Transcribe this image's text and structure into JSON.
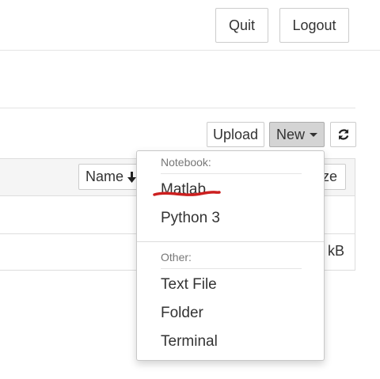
{
  "header": {
    "quit_label": "Quit",
    "logout_label": "Logout"
  },
  "toolbar": {
    "upload_label": "Upload",
    "new_label": "New",
    "refresh_icon": "refresh-icon"
  },
  "file_list": {
    "name_column": "Name",
    "sort_icon": "arrow-down-icon",
    "size_column_partial": "ze",
    "row_size_partial": "kB"
  },
  "new_menu": {
    "notebook_header": "Notebook:",
    "notebook_items": [
      "Matlab",
      "Python 3"
    ],
    "other_header": "Other:",
    "other_items": [
      "Text File",
      "Folder",
      "Terminal"
    ],
    "annotation_color": "#cc1f1f"
  }
}
